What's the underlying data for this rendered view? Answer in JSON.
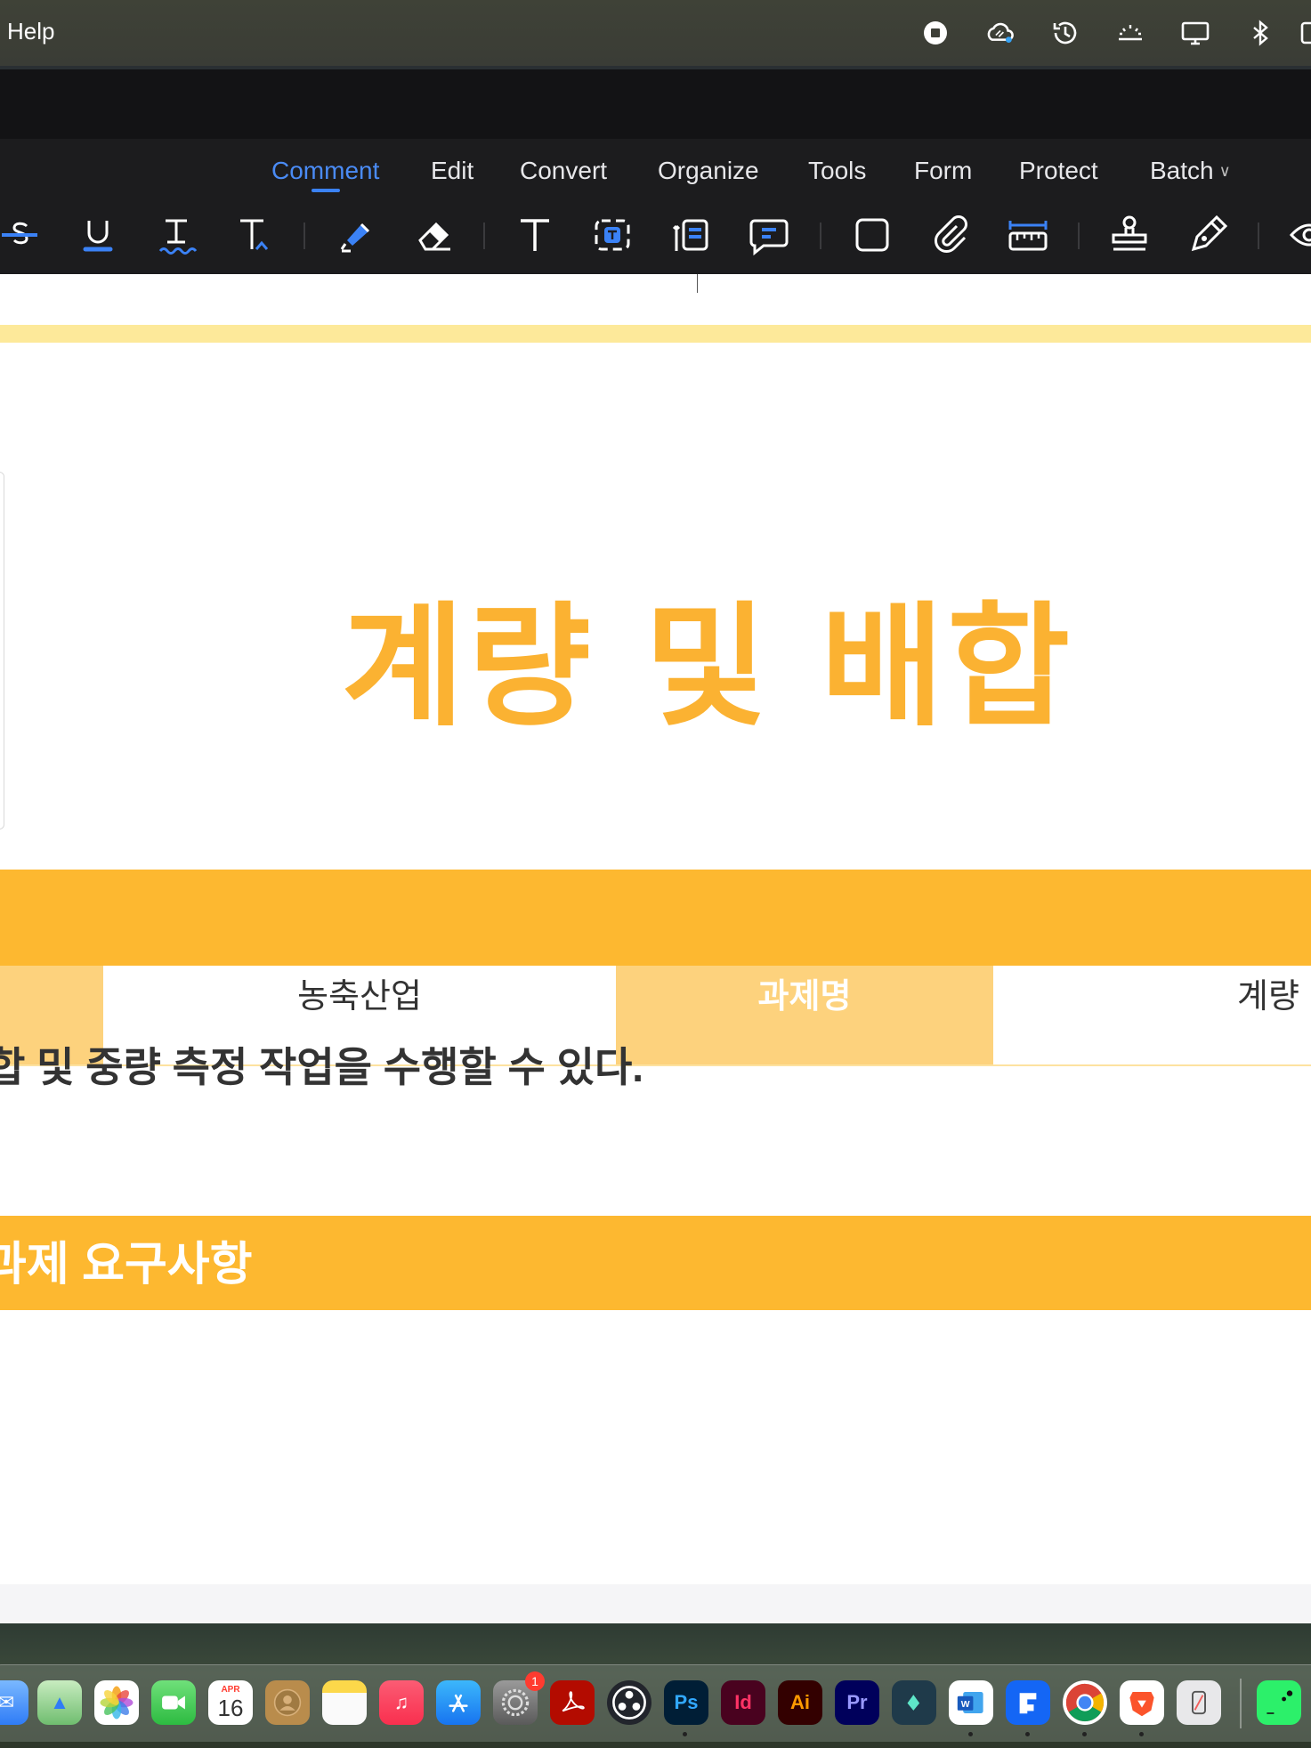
{
  "menubar": {
    "app_menu_help": "Help"
  },
  "status_icons": [
    "stop-record-icon",
    "creative-cloud-icon",
    "time-machine-icon",
    "brightness-icon",
    "display-icon",
    "bluetooth-icon"
  ],
  "tabs": [
    {
      "label": "Comment",
      "active": true
    },
    {
      "label": "Edit"
    },
    {
      "label": "Convert"
    },
    {
      "label": "Organize"
    },
    {
      "label": "Tools"
    },
    {
      "label": "Form"
    },
    {
      "label": "Protect"
    },
    {
      "label": "Batch"
    }
  ],
  "tools": [
    "strikethrough",
    "underline",
    "squiggly",
    "insert-text",
    "highlighter",
    "eraser",
    "text",
    "text-box",
    "callout",
    "note",
    "rectangle",
    "attachment",
    "measure",
    "stamp",
    "signature",
    "eye"
  ],
  "document": {
    "title": "계량 및 배합",
    "info_row": [
      "농축산업",
      "과제명",
      "계량"
    ],
    "sentence": "합 및 중량 측정 작업을 수행할 수 있다.",
    "section_heading": "과제 요구사항"
  },
  "dock": {
    "calendar_month": "APR",
    "calendar_day": "16",
    "settings_badge": "1",
    "labels": {
      "ps": "Ps",
      "id": "Id",
      "ai": "Ai",
      "pr": "Pr"
    }
  },
  "colors": {
    "accent_blue": "#3b82f6",
    "doc_orange": "#fbb232",
    "doc_orange_bar": "#fdb830",
    "doc_orange_light": "#fdd27d"
  }
}
